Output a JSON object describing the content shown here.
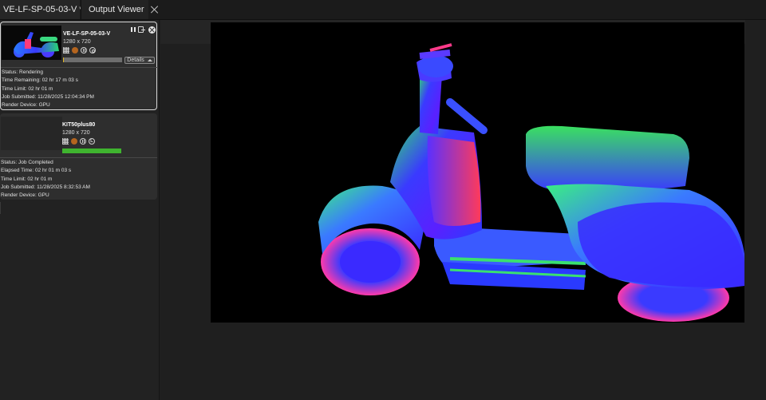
{
  "tabs": [
    {
      "label": "VE-LF-SP-05-03-V *",
      "active": true
    },
    {
      "label": "Output Viewer",
      "active": false
    }
  ],
  "jobs": [
    {
      "name": "VE-LF-SP-05-03-V",
      "resolution": "1280 x 720",
      "progress_percent": 1,
      "progress_color": "#e0b520",
      "details_label": "Details",
      "status": "Status: Rendering",
      "time_line": "Time Remaining: 02 hr 17 m 03 s",
      "time_limit": "Time Limit: 02 hr 01 m",
      "submitted": "Job Submitted: 11/28/2025 12:04:34 PM",
      "device": "Render Device: GPU",
      "icons": [
        "grid-icon",
        "material-icon",
        "pause-stream-icon",
        "target-icon"
      ]
    },
    {
      "name": "KIT50plus80",
      "resolution": "1280 x 720",
      "progress_percent": 100,
      "progress_color": "#3fb42f",
      "status": "Status: Job Completed",
      "time_line": "Elapsed Time: 02 hr 01 m 03 s",
      "time_limit": "Time Limit: 02 hr 01 m",
      "submitted": "Job Submitted: 11/28/2025 8:32:53 AM",
      "device": "Render Device: GPU",
      "icons": [
        "grid-icon",
        "material-icon",
        "pause-stream-icon",
        "lock-icon"
      ]
    }
  ],
  "colors": {
    "background": "#1f1f1f",
    "panel": "#222222",
    "card": "#2e2e2e",
    "selected_border": "#d7d7d7"
  }
}
